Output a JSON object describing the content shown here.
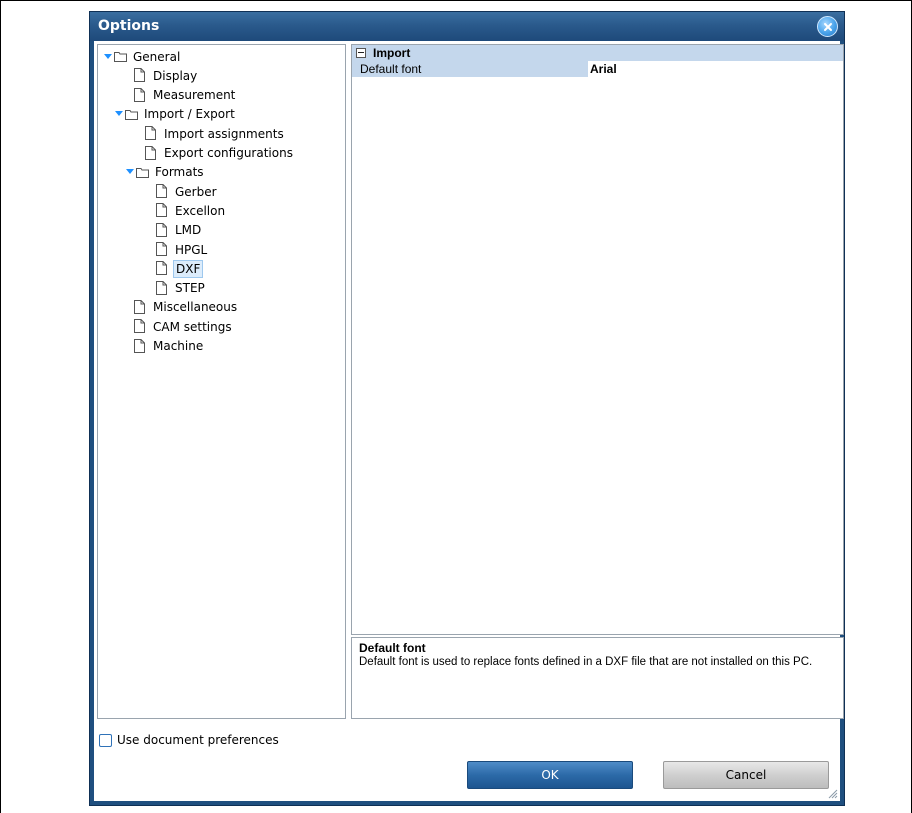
{
  "dialog": {
    "title": "Options",
    "close_icon": "close-x-icon"
  },
  "tree": {
    "items": [
      {
        "label": "General",
        "level": 0,
        "type": "folder",
        "expanded": true
      },
      {
        "label": "Display",
        "level": 1,
        "type": "page"
      },
      {
        "label": "Measurement",
        "level": 1,
        "type": "page"
      },
      {
        "label": "Import / Export",
        "level": 1,
        "type": "folder",
        "expanded": true
      },
      {
        "label": "Import assignments",
        "level": 2,
        "type": "page"
      },
      {
        "label": "Export configurations",
        "level": 2,
        "type": "page"
      },
      {
        "label": "Formats",
        "level": 2,
        "type": "folder",
        "expanded": true
      },
      {
        "label": "Gerber",
        "level": 3,
        "type": "page"
      },
      {
        "label": "Excellon",
        "level": 3,
        "type": "page"
      },
      {
        "label": "LMD",
        "level": 3,
        "type": "page"
      },
      {
        "label": "HPGL",
        "level": 3,
        "type": "page"
      },
      {
        "label": "DXF",
        "level": 3,
        "type": "page",
        "selected": true
      },
      {
        "label": "STEP",
        "level": 3,
        "type": "page"
      },
      {
        "label": "Miscellaneous",
        "level": 1,
        "type": "page"
      },
      {
        "label": "CAM settings",
        "level": 1,
        "type": "page"
      },
      {
        "label": "Machine",
        "level": 1,
        "type": "page"
      }
    ]
  },
  "propgrid": {
    "category": "Import",
    "property_name": "Default font",
    "property_value": "Arial"
  },
  "description": {
    "title": "Default font",
    "text": "Default font is used to replace fonts defined in a DXF file that are not installed on this PC."
  },
  "checkbox": {
    "label": "Use document preferences",
    "checked": false
  },
  "buttons": {
    "ok": "OK",
    "cancel": "Cancel"
  },
  "colors": {
    "title_bar": "#2a5a8c",
    "selection": "#dcecfb",
    "category_row": "#c4d7ec",
    "ok_button": "#2c6aa8",
    "tree_expander": "#1e90ff"
  }
}
